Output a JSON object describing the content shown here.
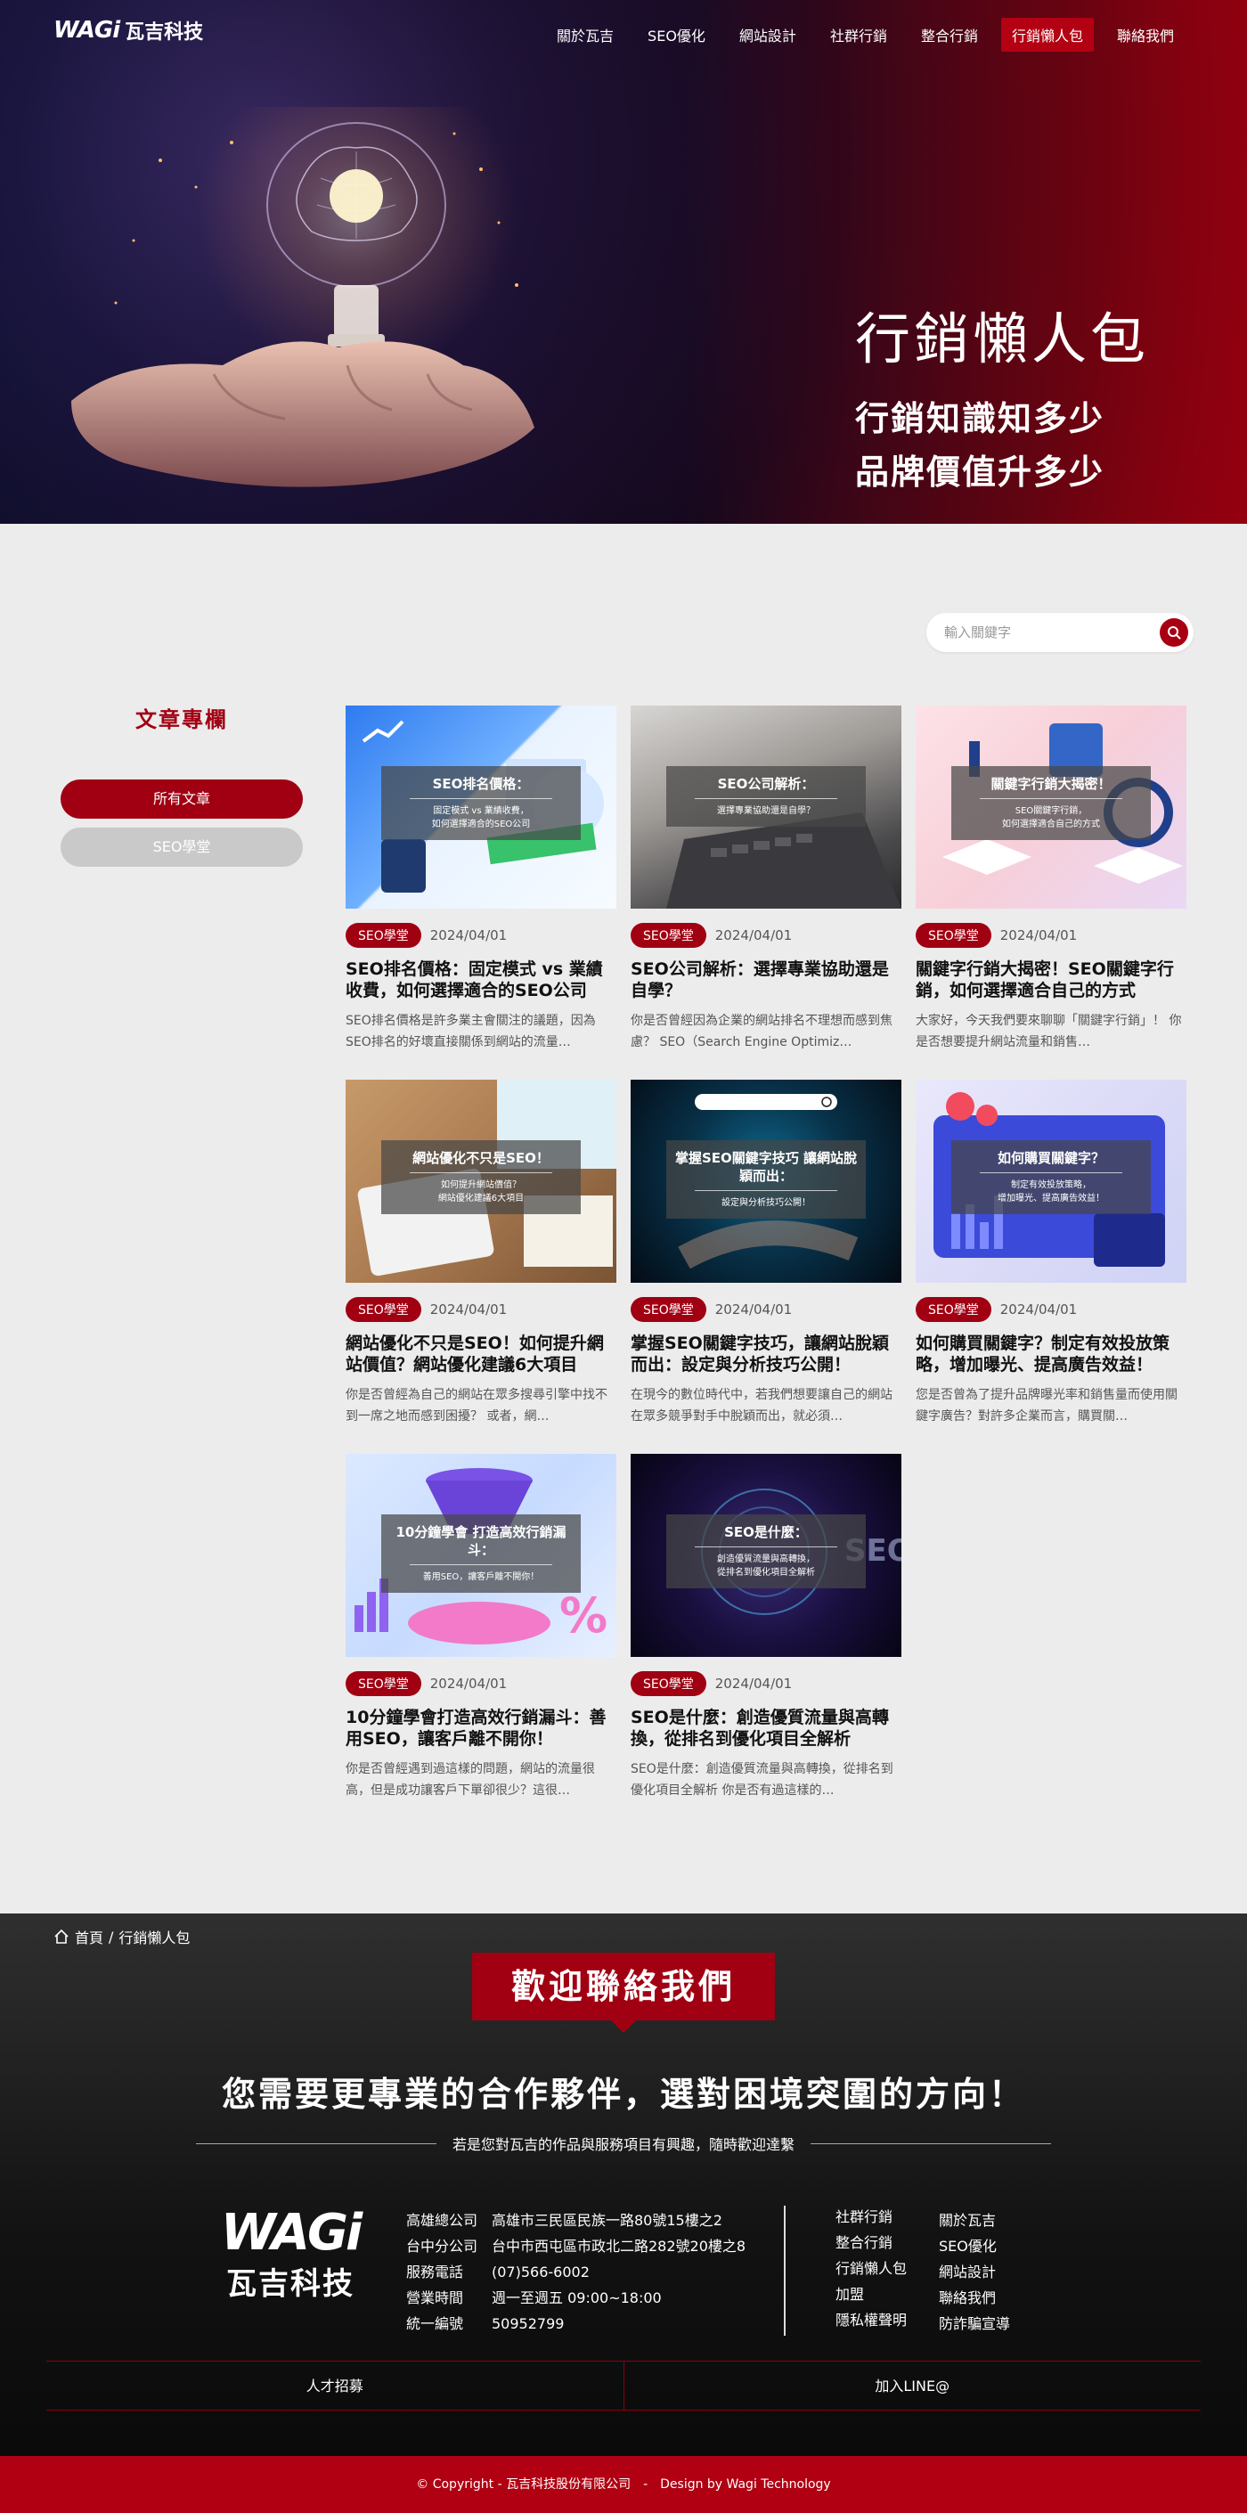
{
  "header": {
    "logo_mark": "WAGi",
    "logo_text": "瓦吉科技",
    "menu": [
      {
        "label": "關於瓦吉"
      },
      {
        "label": "SEO優化"
      },
      {
        "label": "網站設計"
      },
      {
        "label": "社群行銷"
      },
      {
        "label": "整合行銷"
      },
      {
        "label": "行銷懶人包",
        "active": true
      },
      {
        "label": "聯絡我們"
      }
    ]
  },
  "hero": {
    "title": "行銷懶人包",
    "line1": "行銷知識知多少",
    "line2": "品牌價值升多少"
  },
  "search": {
    "placeholder": "輸入關鍵字"
  },
  "sidebar": {
    "title": "文章專欄",
    "categories": [
      {
        "label": "所有文章",
        "active": true
      },
      {
        "label": "SEO學堂",
        "active": false
      }
    ]
  },
  "articles": [
    {
      "tag": "SEO學堂",
      "date": "2024/04/01",
      "title": "SEO排名價格：固定模式 vs 業績收費，如何選擇適合的SEO公司",
      "excerpt": "SEO排名價格是許多業主會關注的議題，因為SEO排名的好壞直接關係到網站的流量…",
      "thumb_title": "SEO排名價格：",
      "thumb_sub": [
        "固定模式 vs 業績收費，",
        "如何選擇適合的SEO公司"
      ]
    },
    {
      "tag": "SEO學堂",
      "date": "2024/04/01",
      "title": "SEO公司解析：選擇專業協助還是自學？",
      "excerpt": "你是否曾經因為企業的網站排名不理想而感到焦慮？ SEO（Search Engine Optimiz…",
      "thumb_title": "SEO公司解析：",
      "thumb_sub": [
        "選擇專業協助還是自學？"
      ]
    },
    {
      "tag": "SEO學堂",
      "date": "2024/04/01",
      "title": "關鍵字行銷大揭密！SEO關鍵字行銷，如何選擇適合自己的方式",
      "excerpt": "大家好，今天我們要來聊聊「關鍵字行銷」！ 你是否想要提升網站流量和銷售…",
      "thumb_title": "關鍵字行銷大揭密！",
      "thumb_sub": [
        "SEO關鍵字行銷，",
        "如何選擇適合自己的方式"
      ]
    },
    {
      "tag": "SEO學堂",
      "date": "2024/04/01",
      "title": "網站優化不只是SEO！如何提升網站價值？網站優化建議6大項目",
      "excerpt": "你是否曾經為自己的網站在眾多搜尋引擎中找不到一席之地而感到困擾？ 或者，網…",
      "thumb_title": "網站優化不只是SEO！",
      "thumb_sub": [
        "如何提升網站價值？",
        "網站優化建議6大項目"
      ]
    },
    {
      "tag": "SEO學堂",
      "date": "2024/04/01",
      "title": "掌握SEO關鍵字技巧，讓網站脫穎而出：設定與分析技巧公開！",
      "excerpt": "在現今的數位時代中，若我們想要讓自己的網站在眾多競爭對手中脫穎而出，就必須…",
      "thumb_title": "掌握SEO關鍵字技巧 讓網站脫穎而出：",
      "thumb_sub": [
        "設定與分析技巧公開！"
      ]
    },
    {
      "tag": "SEO學堂",
      "date": "2024/04/01",
      "title": "如何購買關鍵字？制定有效投放策略，增加曝光、提高廣告效益！",
      "excerpt": "您是否曾為了提升品牌曝光率和銷售量而使用關鍵字廣告？對許多企業而言，購買關…",
      "thumb_title": "如何購買關鍵字？",
      "thumb_sub": [
        "制定有效投放策略，",
        "增加曝光、提高廣告效益！"
      ]
    },
    {
      "tag": "SEO學堂",
      "date": "2024/04/01",
      "title": "10分鐘學會打造高效行銷漏斗：善用SEO，讓客戶離不開你！",
      "excerpt": "你是否曾經遇到過這樣的問題，網站的流量很高，但是成功讓客戶下單卻很少？這很…",
      "thumb_title": "10分鐘學會 打造高效行銷漏斗：",
      "thumb_sub": [
        "善用SEO，讓客戶離不開你！"
      ]
    },
    {
      "tag": "SEO學堂",
      "date": "2024/04/01",
      "title": "SEO是什麼：創造優質流量與高轉換，從排名到優化項目全解析",
      "excerpt": "SEO是什麼：創造優質流量與高轉換，從排名到優化項目全解析 你是否有過這樣的…",
      "thumb_title": "SEO是什麼：",
      "thumb_sub": [
        "創造優質流量與高轉換，",
        "從排名到優化項目全解析"
      ]
    }
  ],
  "footer": {
    "breadcrumb": {
      "home": "首頁",
      "sep": "/",
      "current": "行銷懶人包"
    },
    "welcome": "歡迎聯絡我們",
    "headline": "您需要更專業的合作夥伴，選對困境突圍的方向！",
    "subline": "若是您對瓦吉的作品與服務項目有興趣，隨時歡迎達繫",
    "logo_mark": "WAGi",
    "logo_text": "瓦吉科技",
    "info": [
      {
        "label": "高雄總公司",
        "value": "高雄市三民區民族一路80號15樓之2"
      },
      {
        "label": "台中分公司",
        "value": "台中市西屯區市政北二路282號20樓之8"
      },
      {
        "label": "服務電話",
        "value": "(07)566-6002"
      },
      {
        "label": "營業時間",
        "value": "週一至週五 09:00~18:00"
      },
      {
        "label": "統一編號",
        "value": "50952799"
      }
    ],
    "links_col1": [
      "社群行銷",
      "整合行銷",
      "行銷懶人包",
      "加盟",
      "隱私權聲明"
    ],
    "links_col2": [
      "關於瓦吉",
      "SEO優化",
      "網站設計",
      "聯絡我們",
      "防詐騙宣導"
    ],
    "bar": [
      "人才招募",
      "加入LINE@"
    ],
    "copyright": "© Copyright - 瓦吉科技股份有限公司　-　Design by Wagi Technology"
  },
  "colors": {
    "brand_red": "#a00012",
    "dark": "#121212"
  }
}
